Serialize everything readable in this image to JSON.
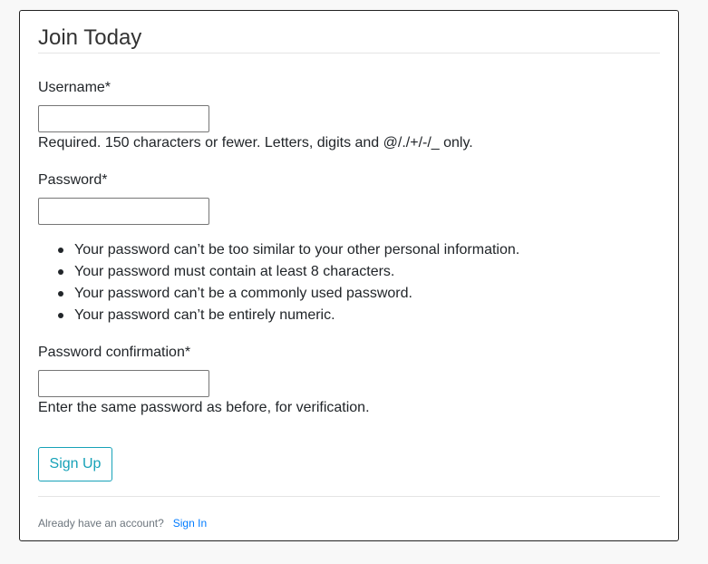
{
  "form": {
    "legend": "Join Today",
    "username": {
      "label": "Username*",
      "value": "",
      "help": "Required. 150 characters or fewer. Letters, digits and @/./+/-/_ only."
    },
    "password": {
      "label": "Password*",
      "value": "",
      "rules": [
        "Your password can’t be too similar to your other personal information.",
        "Your password must contain at least 8 characters.",
        "Your password can’t be a commonly used password.",
        "Your password can’t be entirely numeric."
      ]
    },
    "password_confirmation": {
      "label": "Password confirmation*",
      "value": "",
      "help": "Enter the same password as before, for verification."
    },
    "submit_label": "Sign Up"
  },
  "footer": {
    "prompt": "Already have an account?",
    "link_label": "Sign In"
  },
  "colors": {
    "accent": "#17a2b8",
    "link": "#007bff",
    "muted": "#6c757d"
  }
}
